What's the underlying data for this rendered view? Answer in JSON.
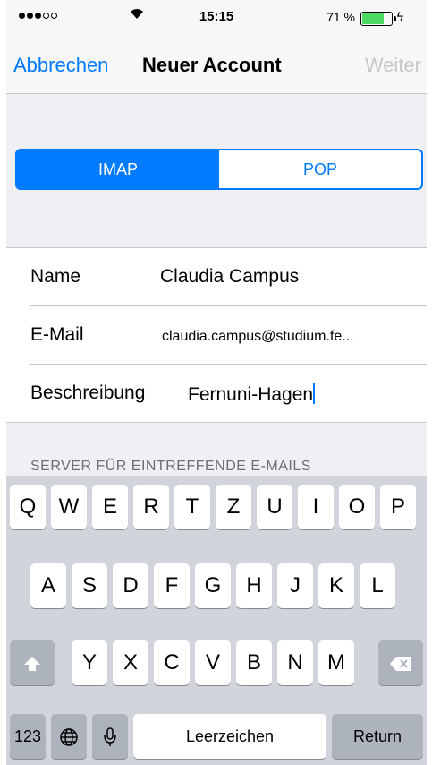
{
  "status_bar": {
    "time": "15:15",
    "battery_text": "71 %",
    "battery_level": 0.71,
    "battery_color": "#4cd964"
  },
  "nav": {
    "cancel_label": "Abbrechen",
    "title": "Neuer Account",
    "next_label": "Weiter"
  },
  "segments": [
    {
      "label": "IMAP",
      "selected": true
    },
    {
      "label": "POP",
      "selected": false
    }
  ],
  "form": {
    "name_label": "Name",
    "name_value": "Claudia Campus",
    "email_label": "E-Mail",
    "email_value": "claudia.campus@studium.fe...",
    "description_label": "Beschreibung",
    "description_value": "Fernuni-Hagen"
  },
  "section_header": "SERVER FÜR EINTREFFENDE E-MAILS",
  "keyboard": {
    "row1": [
      "Q",
      "W",
      "E",
      "R",
      "T",
      "Z",
      "U",
      "I",
      "O",
      "P"
    ],
    "row2": [
      "A",
      "S",
      "D",
      "F",
      "G",
      "H",
      "J",
      "K",
      "L"
    ],
    "row3": [
      "Y",
      "X",
      "C",
      "V",
      "B",
      "N",
      "M"
    ],
    "numbers_label": "123",
    "space_label": "Leerzeichen",
    "return_label": "Return",
    "globe_icon": "globe-icon",
    "mic_icon": "microphone-icon",
    "shift_icon": "shift-icon",
    "delete_icon": "delete-icon"
  },
  "accent_color": "#007aff"
}
